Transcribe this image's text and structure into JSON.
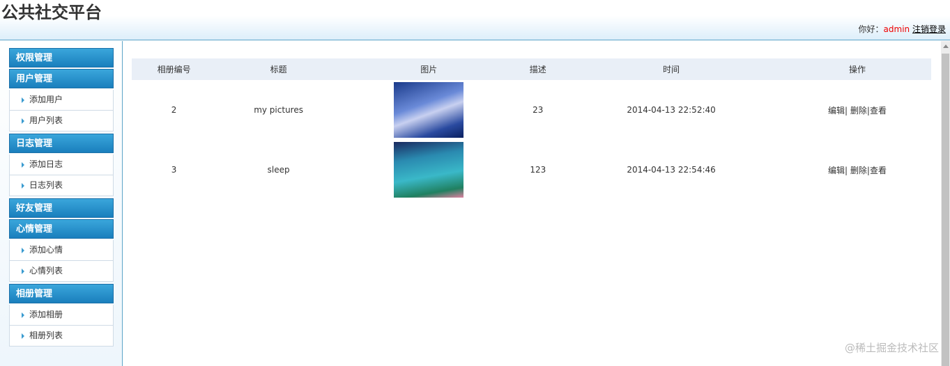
{
  "header": {
    "title": "公共社交平台",
    "greeting": "你好：",
    "username": "admin",
    "logout": "注销登录"
  },
  "sidebar": [
    {
      "label": "权限管理",
      "items": []
    },
    {
      "label": "用户管理",
      "items": [
        "添加用户",
        "用户列表"
      ]
    },
    {
      "label": "日志管理",
      "items": [
        "添加日志",
        "日志列表"
      ]
    },
    {
      "label": "好友管理",
      "items": []
    },
    {
      "label": "心情管理",
      "items": [
        "添加心情",
        "心情列表"
      ]
    },
    {
      "label": "相册管理",
      "items": [
        "添加相册",
        "相册列表"
      ]
    }
  ],
  "table": {
    "columns": [
      "相册编号",
      "标题",
      "图片",
      "描述",
      "时间",
      "操作"
    ],
    "rows": [
      {
        "id": "2",
        "title": "my pictures",
        "desc": "23",
        "time": "2014-04-13 22:52:40",
        "edit": "编辑",
        "del": "删除",
        "view": "查看"
      },
      {
        "id": "3",
        "title": "sleep",
        "desc": "123",
        "time": "2014-04-13 22:54:46",
        "edit": "编辑",
        "del": "删除",
        "view": "查看"
      }
    ]
  },
  "watermark": "@稀土掘金技术社区"
}
